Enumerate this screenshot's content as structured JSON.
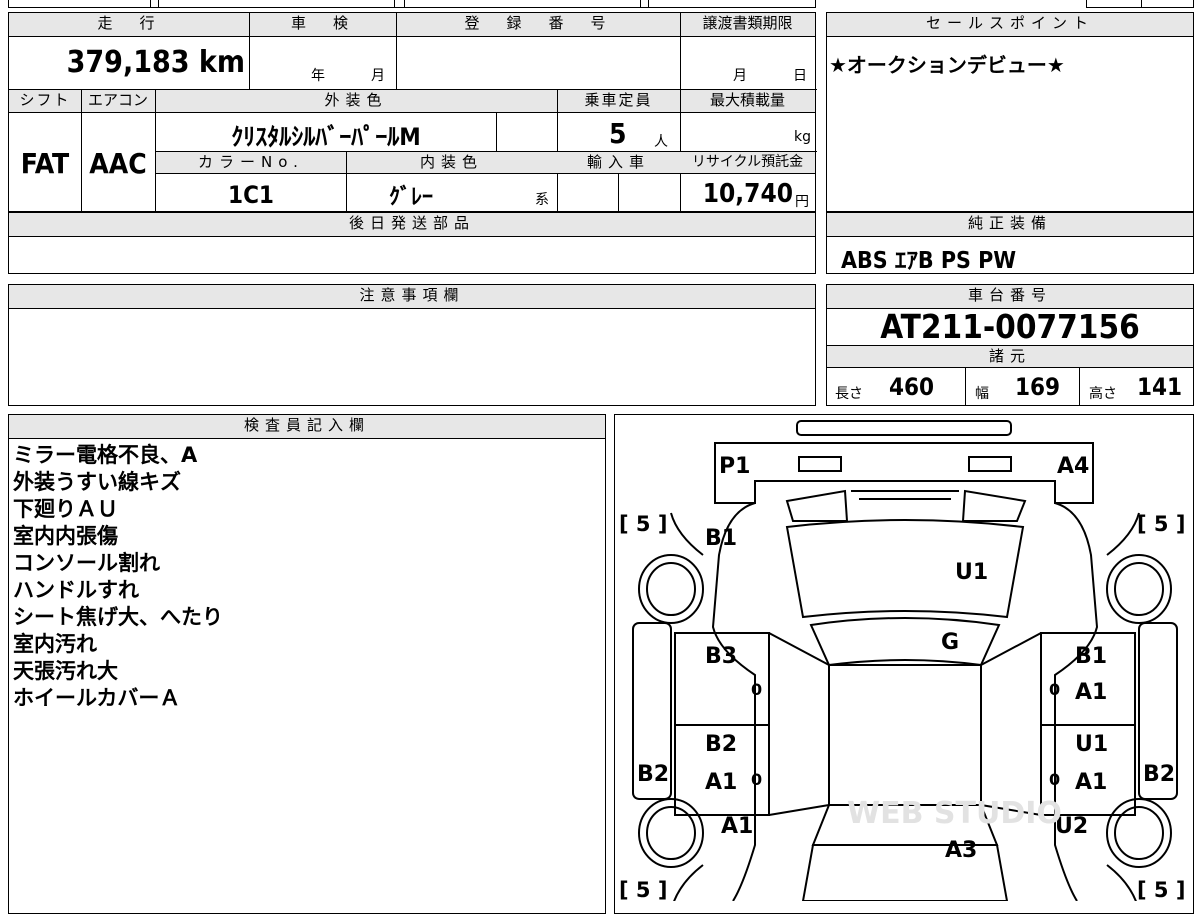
{
  "info": {
    "h_mileage": "走　行",
    "h_inspection": "車　検",
    "h_registration": "登　録　番　号",
    "h_transfer_deadline": "譲渡書類期限",
    "mileage_value": "379,183 km",
    "inspection_year_unit": "年",
    "inspection_month_unit": "月",
    "deadline_month_unit": "月",
    "deadline_day_unit": "日",
    "h_shift": "シフト",
    "h_aircon": "エアコン",
    "h_exterior_color": "外装色",
    "h_capacity": "乗車定員",
    "h_max_load": "最大積載量",
    "shift_value": "FAT",
    "aircon_value": "AAC",
    "exterior_color_value": "ｸﾘｽﾀﾙｼﾙﾊﾞｰﾊﾟｰﾙM",
    "capacity_value": "5",
    "capacity_unit": "人",
    "load_unit": "kg",
    "h_color_no": "カラーNo.",
    "h_interior_color": "内装色",
    "h_import": "輸入車",
    "h_recycle": "リサイクル預託金",
    "color_no_value": "1C1",
    "interior_color_value": "ｸﾞﾚｰ",
    "interior_color_suffix": "系",
    "recycle_value": "10,740",
    "recycle_unit": "円",
    "h_later_parts": "後日発送部品"
  },
  "sales": {
    "header": "セールスポイント",
    "text": "★オークションデビュー★"
  },
  "equipment": {
    "header": "純正装備",
    "text": "ABS ｴｱB PS PW"
  },
  "caution": {
    "header": "注意事項欄"
  },
  "chassis": {
    "header": "車台番号",
    "value": "AT211-0077156",
    "dims_header": "諸元",
    "length_label": "長さ",
    "length_value": "460",
    "width_label": "幅",
    "width_value": "169",
    "height_label": "高さ",
    "height_value": "141"
  },
  "inspector": {
    "header": "検査員記入欄",
    "notes": [
      "ミラー電格不良、A",
      "外装うすい線キズ",
      "下廻りＡＵ",
      "室内内張傷",
      "コンソール割れ",
      "ハンドルすれ",
      "シート焦げ大、へたり",
      "室内汚れ",
      "天張汚れ大",
      "ホイールカバーＡ"
    ]
  },
  "diagram": {
    "labels": {
      "p1": "P1",
      "a4": "A4",
      "b1_front_left": "B1",
      "u1_hood": "U1",
      "g_windshield": "G",
      "b3": "B3",
      "b1_right": "B1",
      "a1_right_upper": "A1",
      "b2_left": "B2",
      "a1_left_door": "A1",
      "u1_right": "U1",
      "a1_right_lower": "A1",
      "b2_side_left": "B2",
      "b2_side_right": "B2",
      "a1_rear_left": "A1",
      "u2_rear_right": "U2",
      "a3_rear": "A3"
    },
    "tire_fl": "[ 5 ]",
    "tire_fr": "[ 5 ]",
    "tire_rl": "[ 5 ]",
    "tire_rr": "[ 5 ]",
    "zero": "0",
    "watermark": "WEB STUDIO"
  }
}
